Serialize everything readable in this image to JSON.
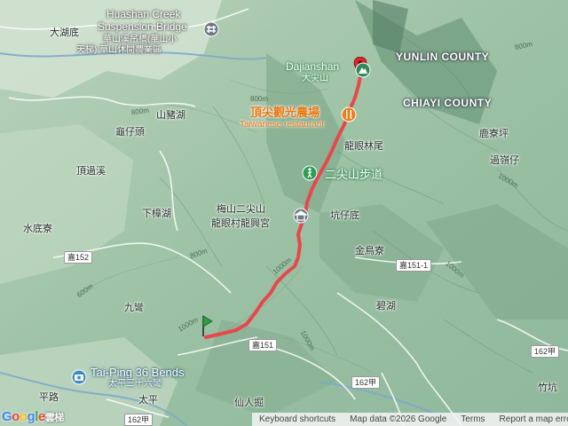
{
  "labels": {
    "bridge_en_1": "Huashan Creek",
    "bridge_en_2": "Suspension Bridge",
    "bridge_zh": "華山溪吊橋(華山小",
    "bridge_zh_2": "天梯) 華山休閒農業區",
    "dahudi": "大湖底",
    "dajianshan_en": "Dajianshan",
    "dajianshan_zh": "大尖山",
    "yunlin": "YUNLIN COUNTY",
    "chiayi": "CHIAYI COUNTY",
    "farm_zh": "頂尖觀光農場",
    "farm_en": "Taiwanese restaurant",
    "shanzhuhu": "山豬湖",
    "guizaitou": "龜仔頭",
    "longyanlinwei": "龍眼林尾",
    "lukengping": "鹿寮坪",
    "guolingzai": "過嶺仔",
    "dingguoxi": "頂過溪",
    "trail": "二尖山步道",
    "temple_1": "梅山二尖山",
    "temple_2": "龍眼村龍興宮",
    "xiazhanghu": "下樟湖",
    "kengzaidi": "坑仔底",
    "shuidiliao": "水底寮",
    "jinniaoliao": "金鳥寮",
    "jiuwan": "九彎",
    "bihu": "碧湖",
    "taiping_en": "Tai-Ping 36 Bends",
    "taiping_zh": "太平三十六彎",
    "pinglu": "平路",
    "taiping": "太平",
    "xianrenjue": "仙人掘",
    "zhukeng": "竹坑",
    "yunti": "雲梯"
  },
  "contours": [
    "800m",
    "800m",
    "800m",
    "1000m",
    "1000m",
    "600m",
    "800m",
    "1000m",
    "1000m",
    "1000m"
  ],
  "road_shields": [
    "嘉152",
    "嘉151-1",
    "嘉151",
    "162甲",
    "162甲",
    "162甲"
  ],
  "footer": {
    "shortcuts": "Keyboard shortcuts",
    "data": "Map data ©2026 Google",
    "terms": "Terms",
    "report": "Report a map error"
  },
  "logo": "Google",
  "colors": {
    "route": "#e8474c",
    "start_pin": "#2e9e44",
    "end_pin": "#d9262b",
    "farm_icon": "#f07d1a",
    "trail_icon": "#2e9e55"
  }
}
